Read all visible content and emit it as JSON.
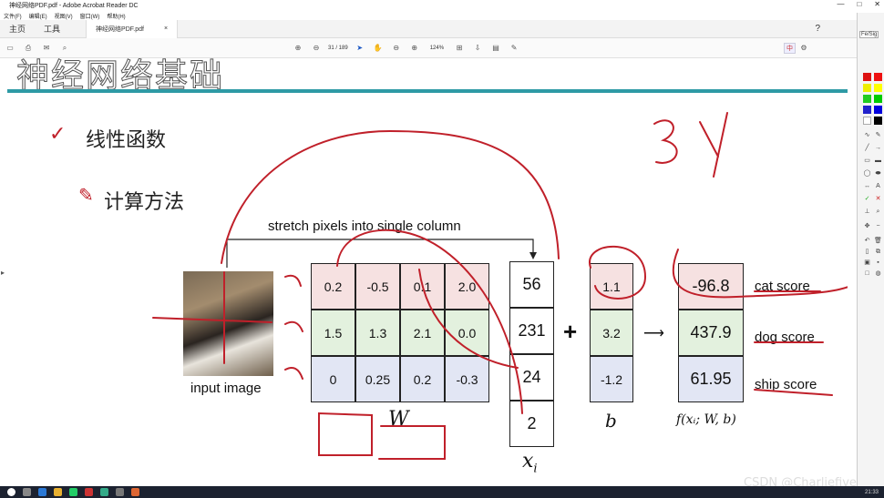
{
  "window": {
    "title": "神经网络PDF.pdf - Adobe Acrobat Reader DC",
    "minimize": "—",
    "maximize": "□",
    "close": "✕"
  },
  "menu": [
    "文件(F)",
    "编辑(E)",
    "视图(V)",
    "窗口(W)",
    "帮助(H)"
  ],
  "tabs": {
    "home": "主页",
    "tools": "工具",
    "doc": "神经网络PDF.pdf",
    "close": "×",
    "help": "?"
  },
  "toolbar": {
    "page_indicator": "31 / 189",
    "zoom": "124%",
    "ime": "中"
  },
  "slide": {
    "title": "神经网络基础",
    "bullet1": "线性函数",
    "bullet2": "计算方法",
    "stretch_label": "stretch pixels into single column",
    "input_label": "input image",
    "W_label": "W",
    "x_label": "x",
    "x_sub": "i",
    "b_label": "b",
    "f_label": "f(xᵢ; W, b)",
    "plus": "+",
    "arrow": "⟶",
    "W": [
      [
        "0.2",
        "-0.5",
        "0.1",
        "2.0"
      ],
      [
        "1.5",
        "1.3",
        "2.1",
        "0.0"
      ],
      [
        "0",
        "0.25",
        "0.2",
        "-0.3"
      ]
    ],
    "x": [
      "56",
      "231",
      "24",
      "2"
    ],
    "b": [
      "1.1",
      "3.2",
      "-1.2"
    ],
    "scores": [
      "-96.8",
      "437.9",
      "61.95"
    ],
    "score_labels": [
      "cat score",
      "dog score",
      "ship score"
    ]
  },
  "sidebar": {
    "header": "Fe/Sig"
  },
  "watermark": "CSDN @Charliefive",
  "clock": "21:33",
  "colors": {
    "teal_rule": "#2e9aa5",
    "row_red": "#f6e1e1",
    "row_green": "#e3f1de",
    "row_blue": "#e2e6f4",
    "ink_red": "#c0202a"
  }
}
